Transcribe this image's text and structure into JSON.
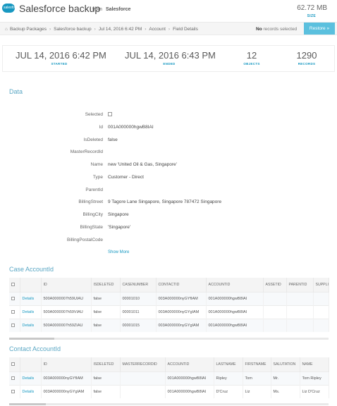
{
  "header": {
    "logo_text": "salesforce",
    "title": "Salesforce backup",
    "from": "from",
    "source": "Salesforce",
    "size_value": "62.72 MB",
    "size_label": "SIZE"
  },
  "breadcrumb": {
    "items": [
      "Backup Packages",
      "Salesforce backup",
      "Jul 14, 2016 6:42 PM",
      "Account",
      "Field Details"
    ],
    "selection_bold": "No",
    "selection_text": "records selected",
    "restore_label": "Restore »"
  },
  "stats": [
    {
      "value": "JUL 14, 2016 6:42 PM",
      "label": "STARTED"
    },
    {
      "value": "JUL 14, 2016 6:43 PM",
      "label": "ENDED"
    },
    {
      "value": "12",
      "label": "OBJECTS"
    },
    {
      "value": "1290",
      "label": "RECORDS"
    }
  ],
  "data_section": {
    "title": "Data",
    "fields": [
      {
        "label": "Selected",
        "value": ""
      },
      {
        "label": "Id",
        "value": "001A000000hgwB8IAI"
      },
      {
        "label": "IsDeleted",
        "value": "false"
      },
      {
        "label": "MasterRecordId",
        "value": ""
      },
      {
        "label": "Name",
        "value": "new 'United Oil & Gas, Singapore'"
      },
      {
        "label": "Type",
        "value": "Customer - Direct"
      },
      {
        "label": "ParentId",
        "value": ""
      },
      {
        "label": "BillingStreet",
        "value": "9 Tagore Lane Singapore, Singapore 787472 Singapore"
      },
      {
        "label": "BillingCity",
        "value": "Singapore"
      },
      {
        "label": "BillingState",
        "value": "'Singapore'"
      },
      {
        "label": "BillingPostalCode",
        "value": ""
      }
    ],
    "show_more": "Show More"
  },
  "case_table": {
    "title": "Case AccountId",
    "columns": [
      "",
      "",
      "ID",
      "ISDELETED",
      "CASENUMBER",
      "CONTACTID",
      "ACCOUNTID",
      "ASSETID",
      "PARENTID",
      "SUPPLIEDN"
    ],
    "rows": [
      [
        "",
        "Details",
        "500A0000007h59UIAU",
        "false",
        "00001010",
        "003A000000nyGYfIAM",
        "001A000000hgwB8IAI",
        "",
        "",
        ""
      ],
      [
        "",
        "Details",
        "500A0000007h59VIAU",
        "false",
        "00001011",
        "003A000000nyGYgIAM",
        "001A000000hgwB8IAI",
        "",
        "",
        ""
      ],
      [
        "",
        "Details",
        "500A0000007h59ZIAU",
        "false",
        "00001015",
        "003A000000nyGYgIAM",
        "001A000000hgwB8IAI",
        "",
        "",
        ""
      ]
    ]
  },
  "contact_table": {
    "title": "Contact AccountId",
    "columns": [
      "",
      "",
      "ID",
      "ISDELETED",
      "MASTERRECORDID",
      "ACCOUNTID",
      "LASTNAME",
      "FIRSTNAME",
      "SALUTATION",
      "NAME"
    ],
    "rows": [
      [
        "",
        "Details",
        "003A000000nyGYfIAM",
        "false",
        "",
        "001A000000hgwB8IAI",
        "Ripley",
        "Tom",
        "Mr.",
        "Tom Ripley"
      ],
      [
        "",
        "Details",
        "003A000000nyGYgIAM",
        "false",
        "",
        "001A000000hgwB8IAI",
        "D'Cruz",
        "Liz",
        "Ms.",
        "Liz D'Cruz"
      ]
    ]
  },
  "colors": {
    "accent": "#1798c1",
    "restore": "#5bc0de",
    "section_title": "#5aa7c4"
  }
}
